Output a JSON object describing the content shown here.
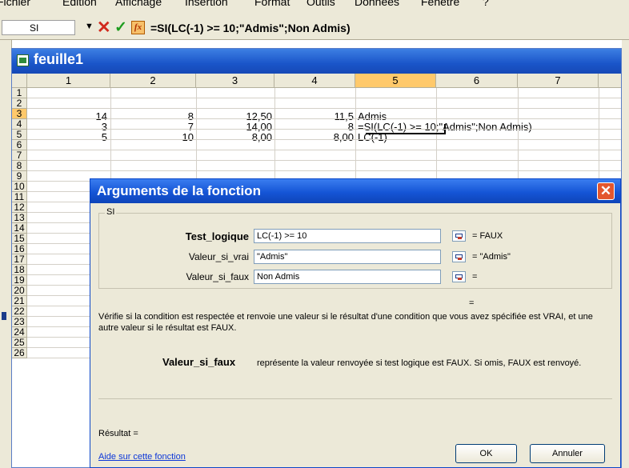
{
  "menu": {
    "items": [
      "Fichier",
      "Edition",
      "Affichage",
      "Insertion",
      "Format",
      "Outils",
      "Données",
      "Fenêtre",
      "?"
    ]
  },
  "formula_bar": {
    "name_box": "SI",
    "formula": "=SI(LC(-1) >= 10;\"Admis\";Non Admis)"
  },
  "workbook": {
    "title": "feuille1"
  },
  "grid": {
    "columns": [
      "1",
      "2",
      "3",
      "4",
      "5",
      "6",
      "7"
    ],
    "rows": [
      "1",
      "2",
      "3",
      "4",
      "5",
      "6",
      "7",
      "8",
      "9",
      "10",
      "11",
      "12",
      "13",
      "14",
      "15",
      "16",
      "17",
      "18",
      "19",
      "20",
      "21",
      "22",
      "23",
      "24",
      "25",
      "26"
    ],
    "cells": {
      "r2c1": "14",
      "r2c2": "8",
      "r2c3": "12,50",
      "r2c4": "11,5",
      "r2c5": "Admis",
      "r3c1": "3",
      "r3c2": "7",
      "r3c3": "14,00",
      "r3c4": "8",
      "r3c5": "=SI(LC(-1) >= 10;\"Admis\";Non Admis)",
      "r4c1": "5",
      "r4c2": "10",
      "r4c3": "8,00",
      "r4c4": "8,00",
      "r4c5": "LC(-1)"
    }
  },
  "dialog": {
    "title": "Arguments de la fonction",
    "group": "SI",
    "args": [
      {
        "label": "Test_logique",
        "value": "LC(-1) >= 10",
        "result": "=  FAUX"
      },
      {
        "label": "Valeur_si_vrai",
        "value": "\"Admis\"",
        "result": "=  \"Admis\""
      },
      {
        "label": "Valeur_si_faux",
        "value": "Non Admis",
        "result": "="
      }
    ],
    "overall_eq": "=",
    "description": "Vérifie si la condition est respectée et renvoie une valeur si le résultat d'une condition que vous avez spécifiée est VRAI, et une autre valeur si le résultat est FAUX.",
    "arg_help_name": "Valeur_si_faux",
    "arg_help_text": "représente la valeur renvoyée si test logique est FAUX. Si omis, FAUX est renvoyé.",
    "result_label": "Résultat =",
    "help_link": "Aide sur cette fonction",
    "ok_label": "OK",
    "cancel_label": "Annuler"
  }
}
